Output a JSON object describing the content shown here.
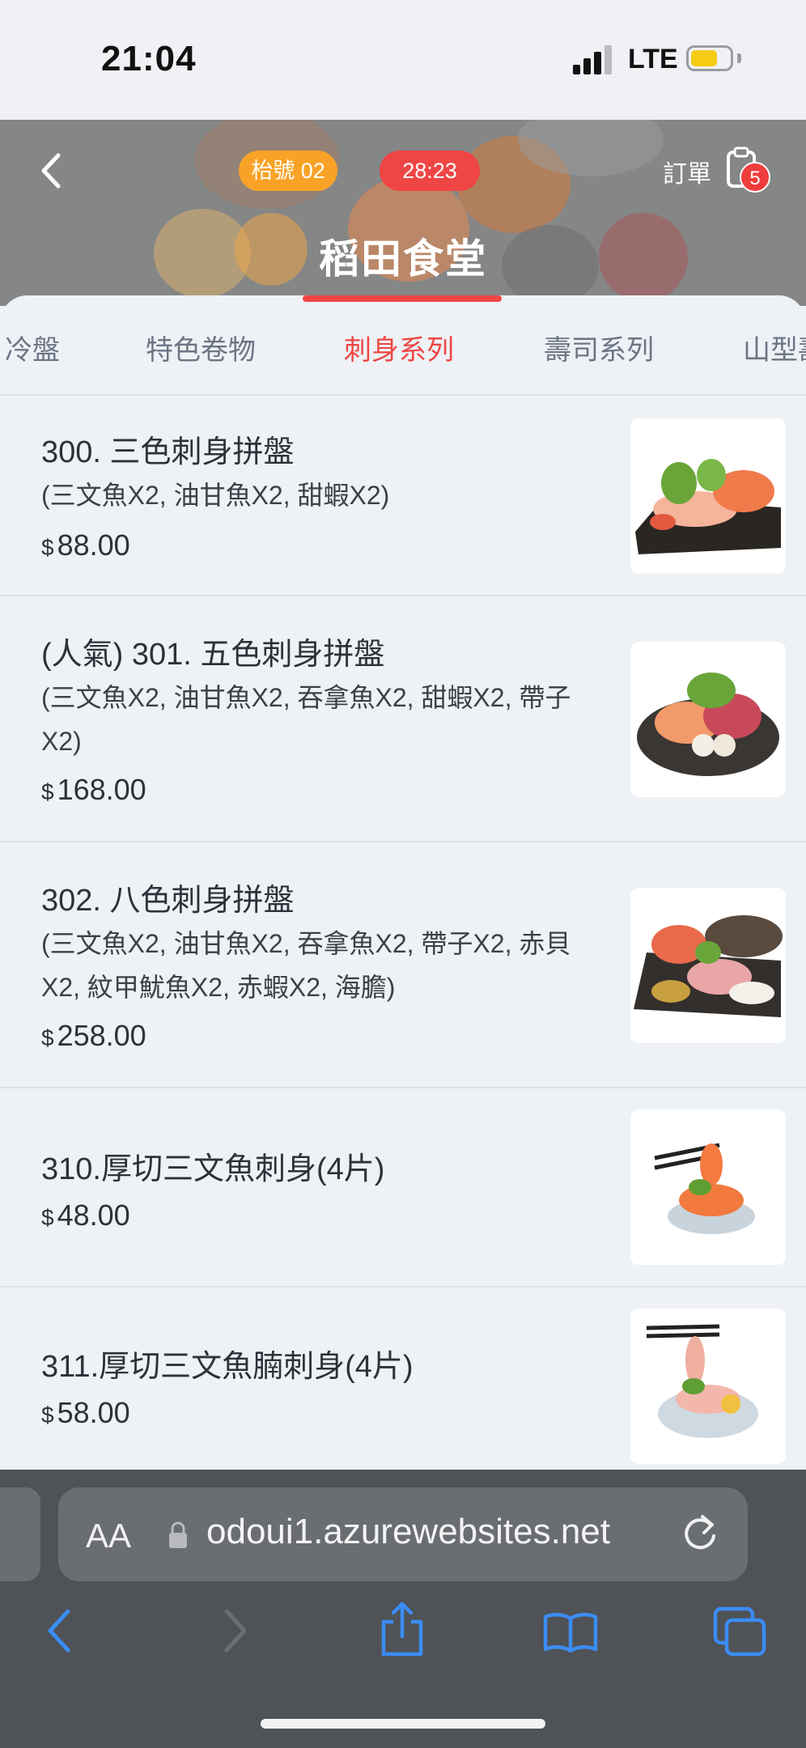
{
  "status_bar": {
    "time": "21:04",
    "network": "LTE"
  },
  "header": {
    "table_label": "枱號 02",
    "timer": "28:23",
    "order_label": "訂單",
    "order_count": "5",
    "store_name": "稻田食堂"
  },
  "tabs": [
    {
      "label": "冷盤",
      "active": false
    },
    {
      "label": "特色卷物",
      "active": false
    },
    {
      "label": "刺身系列",
      "active": true
    },
    {
      "label": "壽司系列",
      "active": false
    },
    {
      "label": "山型壽",
      "active": false
    }
  ],
  "items": [
    {
      "name": "300. 三色刺身拼盤",
      "desc": "(三文魚X2, 油甘魚X2, 甜蝦X2)",
      "currency": "$",
      "price": "88.00"
    },
    {
      "name": "(人氣) 301. 五色刺身拼盤",
      "desc": "(三文魚X2, 油甘魚X2, 吞拿魚X2, 甜蝦X2, 帶子X2)",
      "currency": "$",
      "price": "168.00"
    },
    {
      "name": "302. 八色刺身拼盤",
      "desc": "(三文魚X2, 油甘魚X2, 吞拿魚X2, 帶子X2, 赤貝X2, 紋甲魷魚X2, 赤蝦X2, 海膽)",
      "currency": "$",
      "price": "258.00"
    },
    {
      "name": "310.厚切三文魚刺身(4片)",
      "desc": "",
      "currency": "$",
      "price": "48.00"
    },
    {
      "name": "311.厚切三文魚腩刺身(4片)",
      "desc": "",
      "currency": "$",
      "price": "58.00"
    }
  ],
  "browser": {
    "aa_label": "AA",
    "url": "odoui1.azurewebsites.net"
  },
  "colors": {
    "accent": "#ef4545",
    "table_pill": "#f9a326"
  }
}
